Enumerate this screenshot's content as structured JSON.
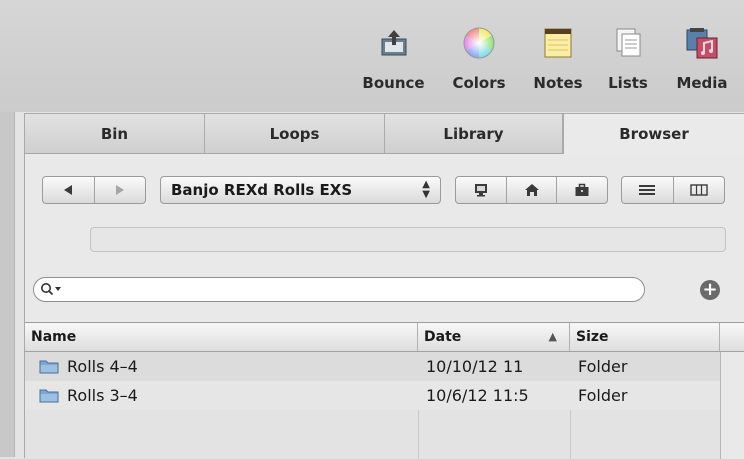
{
  "toolbar": {
    "buttons": [
      {
        "label": "Bounce",
        "icon": "bounce-icon"
      },
      {
        "label": "Colors",
        "icon": "colors-icon"
      },
      {
        "label": "Notes",
        "icon": "notes-icon"
      },
      {
        "label": "Lists",
        "icon": "lists-icon"
      },
      {
        "label": "Media",
        "icon": "media-icon"
      }
    ]
  },
  "tabs": [
    {
      "label": "Bin",
      "active": false
    },
    {
      "label": "Loops",
      "active": false
    },
    {
      "label": "Library",
      "active": false
    },
    {
      "label": "Browser",
      "active": true
    }
  ],
  "nav": {
    "back_icon": "back-arrow-icon",
    "forward_icon": "forward-arrow-icon",
    "location": "Banjo REXd Rolls EXS",
    "location_icons": [
      "computer-icon",
      "home-icon",
      "project-briefcase-icon"
    ],
    "view_icons": [
      "list-view-icon",
      "column-view-icon"
    ]
  },
  "search": {
    "value": "",
    "placeholder": "",
    "icon": "search-icon",
    "add_icon": "add-icon"
  },
  "table": {
    "columns": [
      "Name",
      "Date",
      "Size"
    ],
    "sort_column": "Date",
    "sort_indicator": "▲",
    "rows": [
      {
        "name": "Rolls 4–4",
        "date": "10/10/12 11",
        "size": "Folder",
        "icon": "folder-icon"
      },
      {
        "name": "Rolls 3–4",
        "date": "10/6/12 11:5",
        "size": "Folder",
        "icon": "folder-icon"
      }
    ]
  },
  "colors": {
    "accent": "#6a6a6a",
    "folder": "#7ea7cf"
  }
}
